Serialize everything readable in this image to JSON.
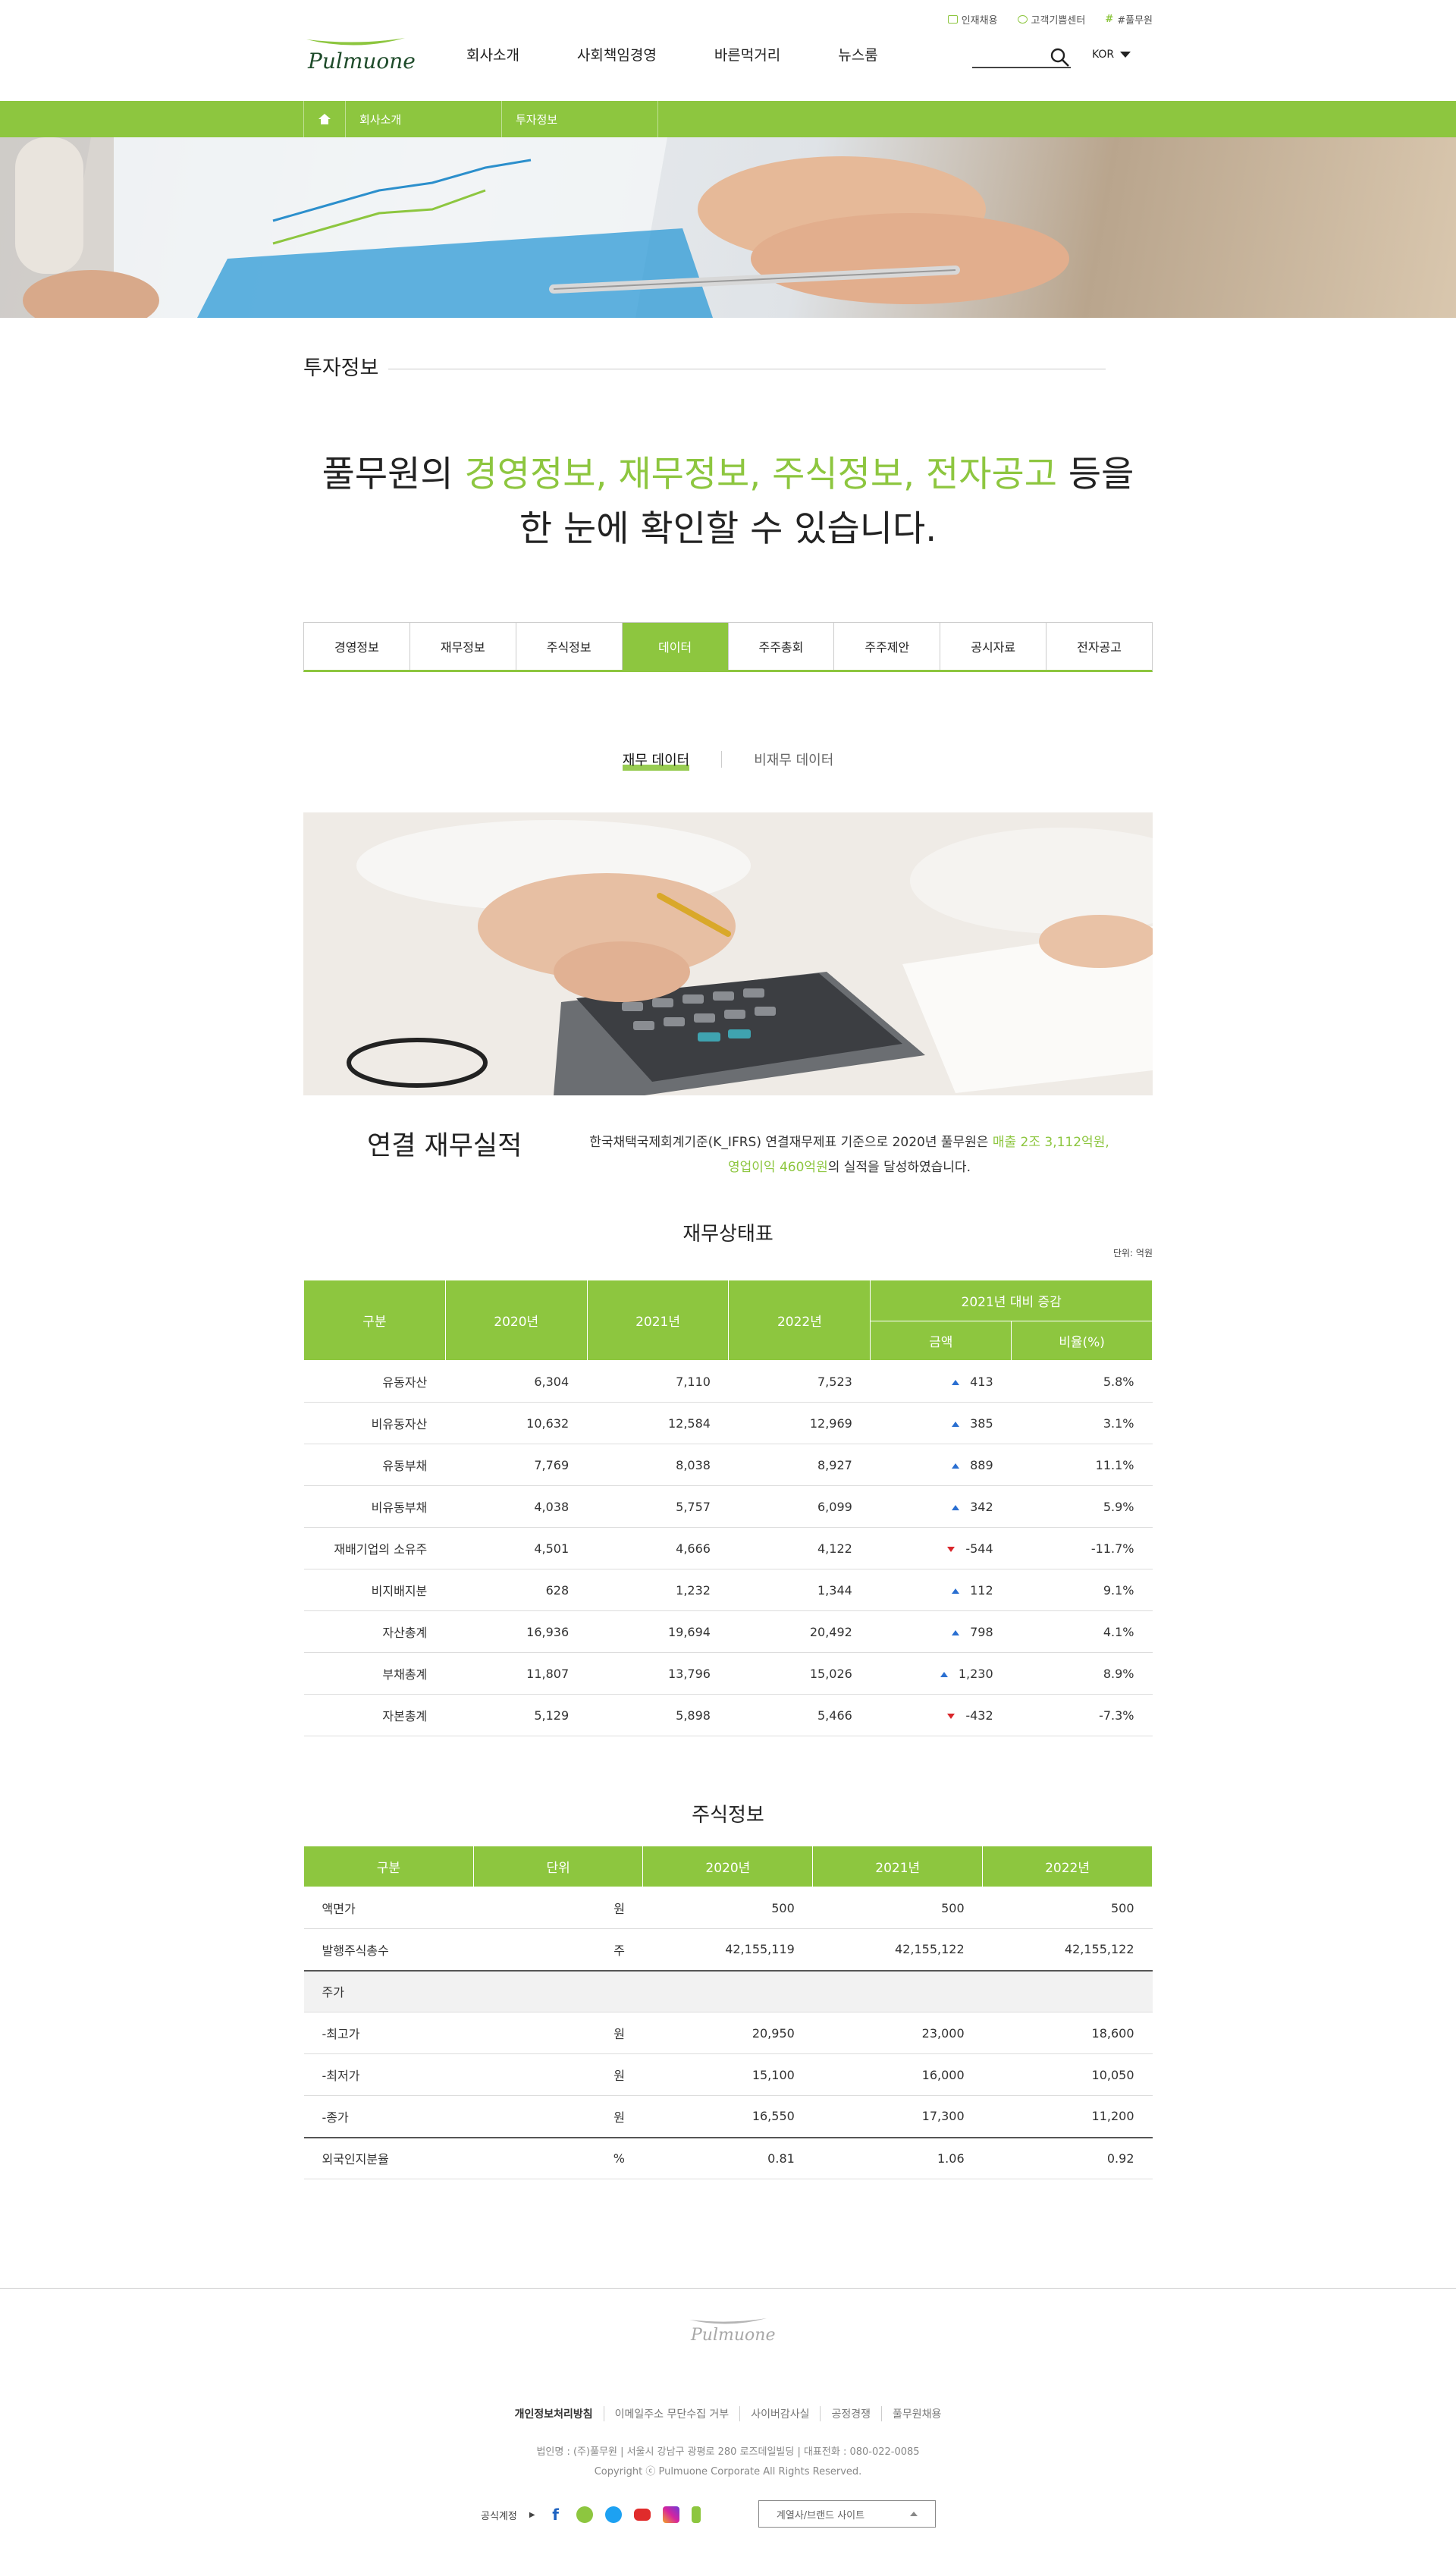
{
  "util_links": [
    "인재채용",
    "고객기쁨센터",
    "#풀무원"
  ],
  "brand": {
    "logo_text": "Pulmuone",
    "accent": "#8dc63f"
  },
  "gnb": [
    "회사소개",
    "사회책임경영",
    "바른먹거리",
    "뉴스룸"
  ],
  "lang": "KOR",
  "breadcrumb": [
    "회사소개",
    "투자정보"
  ],
  "section_title": "투자정보",
  "headline": {
    "p1": "풀무원의 ",
    "g1": "경영정보, 재무정보, 주식정보, 전자공고",
    "p2": " 등을",
    "line2": "한 눈에 확인할 수 있습니다."
  },
  "tabs": [
    "경영정보",
    "재무정보",
    "주식정보",
    "데이터",
    "주주총회",
    "주주제안",
    "공시자료",
    "전자공고"
  ],
  "active_tab": "데이터",
  "subtabs": [
    "재무 데이터",
    "비재무 데이터"
  ],
  "summary": {
    "title": "연결 재무실적",
    "t1": "한국채택국제회계기준(K_IFRS) 연결재무제표 기준으로 2020년 풀무원은 ",
    "g1": "매출 2조 3,112억원,",
    "g2": "영업이익 460억원",
    "t2": "의 실적을 달성하였습니다."
  },
  "balance": {
    "caption": "재무상태표",
    "unit": "단위: 억원",
    "headers": [
      "구분",
      "2020년",
      "2021년",
      "2022년",
      "2021년 대비 증감",
      "금액",
      "비율(%)"
    ],
    "rows": [
      {
        "label": "유동자산",
        "y2020": "6,304",
        "y2021": "7,110",
        "y2022": "7,523",
        "dir": "up",
        "amt": "413",
        "pct": "5.8%"
      },
      {
        "label": "비유동자산",
        "y2020": "10,632",
        "y2021": "12,584",
        "y2022": "12,969",
        "dir": "up",
        "amt": "385",
        "pct": "3.1%"
      },
      {
        "label": "유동부채",
        "y2020": "7,769",
        "y2021": "8,038",
        "y2022": "8,927",
        "dir": "up",
        "amt": "889",
        "pct": "11.1%"
      },
      {
        "label": "비유동부채",
        "y2020": "4,038",
        "y2021": "5,757",
        "y2022": "6,099",
        "dir": "up",
        "amt": "342",
        "pct": "5.9%"
      },
      {
        "label": "재배기업의 소유주",
        "y2020": "4,501",
        "y2021": "4,666",
        "y2022": "4,122",
        "dir": "down",
        "amt": "-544",
        "pct": "-11.7%"
      },
      {
        "label": "비지배지분",
        "y2020": "628",
        "y2021": "1,232",
        "y2022": "1,344",
        "dir": "up",
        "amt": "112",
        "pct": "9.1%"
      },
      {
        "label": "자산총계",
        "y2020": "16,936",
        "y2021": "19,694",
        "y2022": "20,492",
        "dir": "up",
        "amt": "798",
        "pct": "4.1%"
      },
      {
        "label": "부채총계",
        "y2020": "11,807",
        "y2021": "13,796",
        "y2022": "15,026",
        "dir": "up",
        "amt": "1,230",
        "pct": "8.9%"
      },
      {
        "label": "자본총계",
        "y2020": "5,129",
        "y2021": "5,898",
        "y2022": "5,466",
        "dir": "down",
        "amt": "-432",
        "pct": "-7.3%"
      }
    ]
  },
  "stock": {
    "caption": "주식정보",
    "headers": [
      "구분",
      "단위",
      "2020년",
      "2021년",
      "2022년"
    ],
    "rows": [
      {
        "label": "액면가",
        "unit": "원",
        "v1": "500",
        "v2": "500",
        "v3": "500"
      },
      {
        "label": "발행주식총수",
        "unit": "주",
        "v1": "42,155,119",
        "v2": "42,155,122",
        "v3": "42,155,122"
      },
      {
        "label": "주가",
        "unit": "",
        "v1": "",
        "v2": "",
        "v3": "",
        "group": true
      },
      {
        "label": "-최고가",
        "unit": "원",
        "v1": "20,950",
        "v2": "23,000",
        "v3": "18,600"
      },
      {
        "label": "-최저가",
        "unit": "원",
        "v1": "15,100",
        "v2": "16,000",
        "v3": "10,050"
      },
      {
        "label": "-종가",
        "unit": "원",
        "v1": "16,550",
        "v2": "17,300",
        "v3": "11,200"
      },
      {
        "label": "외국인지분율",
        "unit": "%",
        "v1": "0.81",
        "v2": "1.06",
        "v3": "0.92",
        "after": true
      }
    ]
  },
  "footer": {
    "logo_text": "Pulmuone",
    "links": [
      "개인정보처리방침",
      "이메일주소 무단수집 거부",
      "사이버감사실",
      "공정경쟁",
      "풀무원채용"
    ],
    "info1": "법인명 : (주)풀무원   |   서울시 강남구 광평로 280 로즈데일빌딩   |   대표전화 : 080-022-0085",
    "copyright": "Copyright ⓒ Pulmuone Corporate All Rights Reserved.",
    "social_label": "공식계정",
    "family_label": "계열사/브랜드 사이트"
  }
}
